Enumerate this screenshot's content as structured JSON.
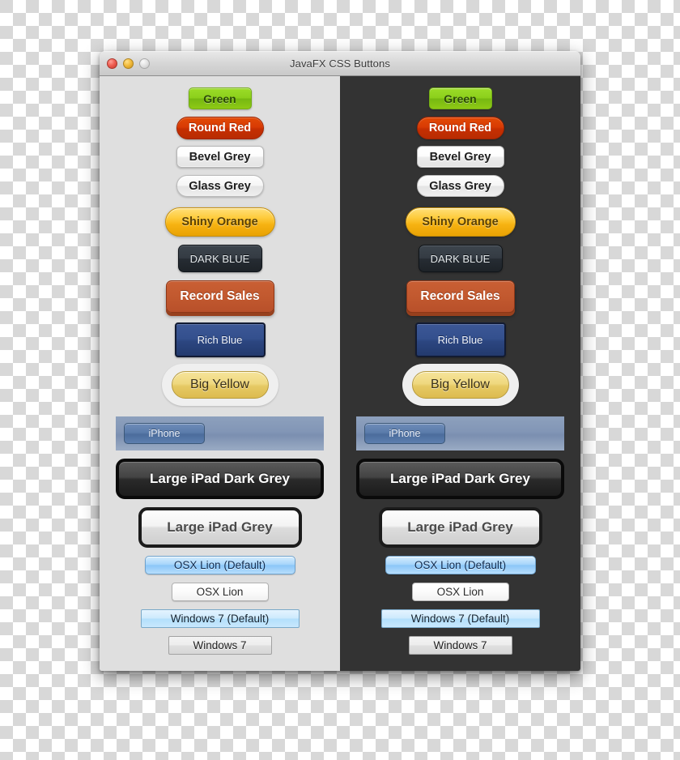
{
  "window": {
    "title": "JavaFX CSS Buttons",
    "traffic_lights": [
      {
        "name": "close",
        "color": "#ef5f53"
      },
      {
        "name": "minimize",
        "color": "#f3bc3e"
      },
      {
        "name": "zoom",
        "color": "#e2e2e2"
      }
    ]
  },
  "panels": {
    "light": {
      "background": "#dfdfdf"
    },
    "dark": {
      "background": "#333333"
    }
  },
  "buttons": [
    {
      "id": "green",
      "label": "Green"
    },
    {
      "id": "round-red",
      "label": "Round Red"
    },
    {
      "id": "bevel-grey",
      "label": "Bevel Grey"
    },
    {
      "id": "glass-grey",
      "label": "Glass Grey"
    },
    {
      "id": "shiny-orange",
      "label": "Shiny Orange"
    },
    {
      "id": "dark-blue",
      "label": "DARK BLUE"
    },
    {
      "id": "record-sales",
      "label": "Record Sales"
    },
    {
      "id": "rich-blue",
      "label": "Rich Blue"
    },
    {
      "id": "big-yellow",
      "label": "Big Yellow"
    },
    {
      "id": "iphone",
      "label": "iPhone"
    },
    {
      "id": "ipad-dark",
      "label": "Large iPad Dark Grey"
    },
    {
      "id": "ipad-grey",
      "label": "Large iPad Grey"
    },
    {
      "id": "osx-default",
      "label": "OSX Lion (Default)"
    },
    {
      "id": "osx",
      "label": "OSX Lion"
    },
    {
      "id": "win-default",
      "label": "Windows 7 (Default)"
    },
    {
      "id": "win",
      "label": "Windows 7"
    }
  ]
}
